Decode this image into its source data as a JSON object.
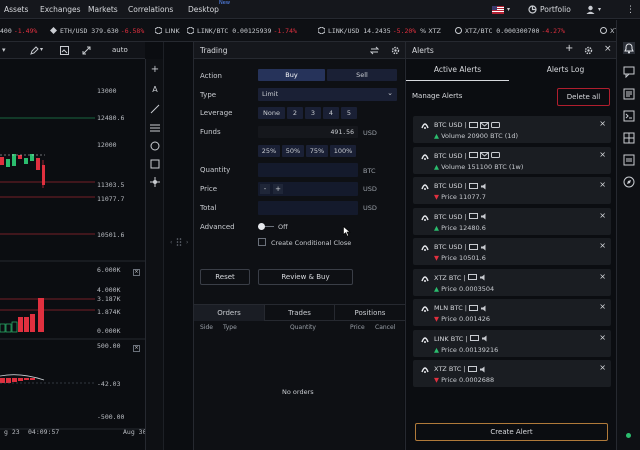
{
  "nav": {
    "items": [
      "Assets",
      "Exchanges",
      "Markets",
      "Correlations",
      "Desktop"
    ],
    "new_badge": "New",
    "portfolio": "Portfolio"
  },
  "ticker": [
    {
      "pair": "400",
      "change": "-1.49%",
      "dir": "neg"
    },
    {
      "pair": "ETH/USD 379.630",
      "change": "-6.58%",
      "dir": "neg"
    },
    {
      "pair": "LINK",
      "change": "",
      "dir": ""
    },
    {
      "pair": "LINK/BTC 0.00125939",
      "change": "-1.74%",
      "dir": "neg"
    },
    {
      "pair": "LINK/USD 14.2435",
      "change": "-5.20%",
      "dir": "neg"
    },
    {
      "pair": "% XTZ",
      "change": "",
      "dir": ""
    },
    {
      "pair": "XTZ/BTC 0.000300700",
      "change": "-4.27%",
      "dir": "neg"
    },
    {
      "pair": "XTZ/U",
      "change": "",
      "dir": ""
    }
  ],
  "chart": {
    "interval": "auto",
    "price_labels": [
      "13000",
      "12480.6",
      "12000",
      "11303.5",
      "11077.7",
      "10501.6"
    ],
    "volume_labels": [
      "6.000K",
      "4.000K",
      "3.187K",
      "1.874K",
      "0.000K"
    ],
    "osc_labels": [
      "500.00",
      "-42.03",
      "-500.00"
    ],
    "time_labels": [
      "g 23",
      "04:09:57",
      "Aug 30"
    ]
  },
  "trading": {
    "title": "Trading",
    "action_label": "Action",
    "buy": "Buy",
    "sell": "Sell",
    "type_label": "Type",
    "type_value": "Limit",
    "leverage_label": "Leverage",
    "leverage_options": [
      "None",
      "2",
      "3",
      "4",
      "5"
    ],
    "funds_label": "Funds",
    "funds_value": "491.56",
    "funds_unit": "USD",
    "pct_options": [
      "25%",
      "50%",
      "75%",
      "100%"
    ],
    "quantity_label": "Quantity",
    "quantity_unit": "BTC",
    "price_label": "Price",
    "price_unit": "USD",
    "minus": "-",
    "plus": "+",
    "total_label": "Total",
    "total_unit": "USD",
    "advanced_label": "Advanced",
    "advanced_state": "Off",
    "conditional_close": "Create Conditional Close",
    "reset": "Reset",
    "review_buy": "Review & Buy"
  },
  "orders": {
    "tabs": [
      "Orders",
      "Trades",
      "Positions"
    ],
    "columns": [
      "Side",
      "Type",
      "Quantity",
      "Price",
      "Cancel"
    ],
    "empty": "No orders"
  },
  "alerts": {
    "title": "Alerts",
    "tabs": [
      "Active Alerts",
      "Alerts Log"
    ],
    "manage": "Manage Alerts",
    "delete_all": "Delete all",
    "create": "Create Alert",
    "items": [
      {
        "title": "BTC USD |",
        "dir": "up",
        "detail": "Volume 20900 BTC (1d)",
        "icons": 3
      },
      {
        "title": "BTC USD |",
        "dir": "up",
        "detail": "Volume 151100 BTC (1w)",
        "icons": 3
      },
      {
        "title": "BTC USD |",
        "dir": "down",
        "detail": "Price 11077.7",
        "icons": 2
      },
      {
        "title": "BTC USD |",
        "dir": "up",
        "detail": "Price 12480.6",
        "icons": 2
      },
      {
        "title": "BTC USD |",
        "dir": "down",
        "detail": "Price 10501.6",
        "icons": 2
      },
      {
        "title": "XTZ BTC |",
        "dir": "up",
        "detail": "Price 0.0003504",
        "icons": 2
      },
      {
        "title": "MLN BTC |",
        "dir": "down",
        "detail": "Price 0.001426",
        "icons": 2
      },
      {
        "title": "LINK BTC |",
        "dir": "up",
        "detail": "Price 0.00139216",
        "icons": 2
      },
      {
        "title": "XTZ BTC |",
        "dir": "down",
        "detail": "Price 0.0002688",
        "icons": 2
      }
    ]
  },
  "colors": {
    "up": "#2bbd6e",
    "down": "#e0303f",
    "accent": "#26335a",
    "danger": "#b01e2e"
  }
}
